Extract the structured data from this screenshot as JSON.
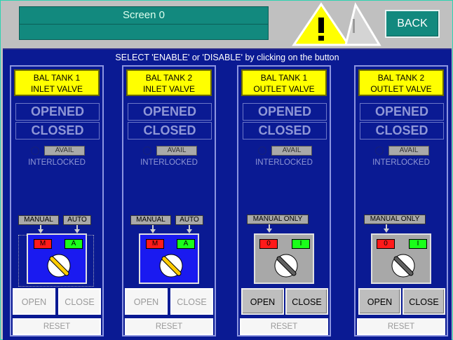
{
  "header": {
    "screen_title": "Screen 0",
    "back_label": "BACK"
  },
  "instruction": "SELECT 'ENABLE' or 'DISABLE' by clicking on the button",
  "panels": [
    {
      "title_line1": "BAL TANK 1",
      "title_line2": "INLET VALVE",
      "opened": "OPENED",
      "closed": "CLOSED",
      "avail": "AVAIL",
      "interlocked": "INTERLOCKED",
      "mode_left": "MANUAL",
      "mode_right": "AUTO",
      "ind_left": "M",
      "ind_right": "A",
      "open": "OPEN",
      "close": "CLOSE",
      "reset": "RESET"
    },
    {
      "title_line1": "BAL TANK 2",
      "title_line2": "INLET VALVE",
      "opened": "OPENED",
      "closed": "CLOSED",
      "avail": "AVAIL",
      "interlocked": "INTERLOCKED",
      "mode_left": "MANUAL",
      "mode_right": "AUTO",
      "ind_left": "M",
      "ind_right": "A",
      "open": "OPEN",
      "close": "CLOSE",
      "reset": "RESET"
    },
    {
      "title_line1": "BAL TANK 1",
      "title_line2": "OUTLET VALVE",
      "opened": "OPENED",
      "closed": "CLOSED",
      "avail": "AVAIL",
      "interlocked": "INTERLOCKED",
      "mode_only": "MANUAL ONLY",
      "ind_left": "0",
      "ind_right": "I",
      "open": "OPEN",
      "close": "CLOSE",
      "reset": "RESET"
    },
    {
      "title_line1": "BAL TANK 2",
      "title_line2": "OUTLET VALVE",
      "opened": "OPENED",
      "closed": "CLOSED",
      "avail": "AVAIL",
      "interlocked": "INTERLOCKED",
      "mode_only": "MANUAL ONLY",
      "ind_left": "0",
      "ind_right": "I",
      "open": "OPEN",
      "close": "CLOSE",
      "reset": "RESET"
    }
  ],
  "colors": {
    "panel_bg": "#0a1a93",
    "title_bg": "#ffff00",
    "header_teal": "#12897e"
  }
}
